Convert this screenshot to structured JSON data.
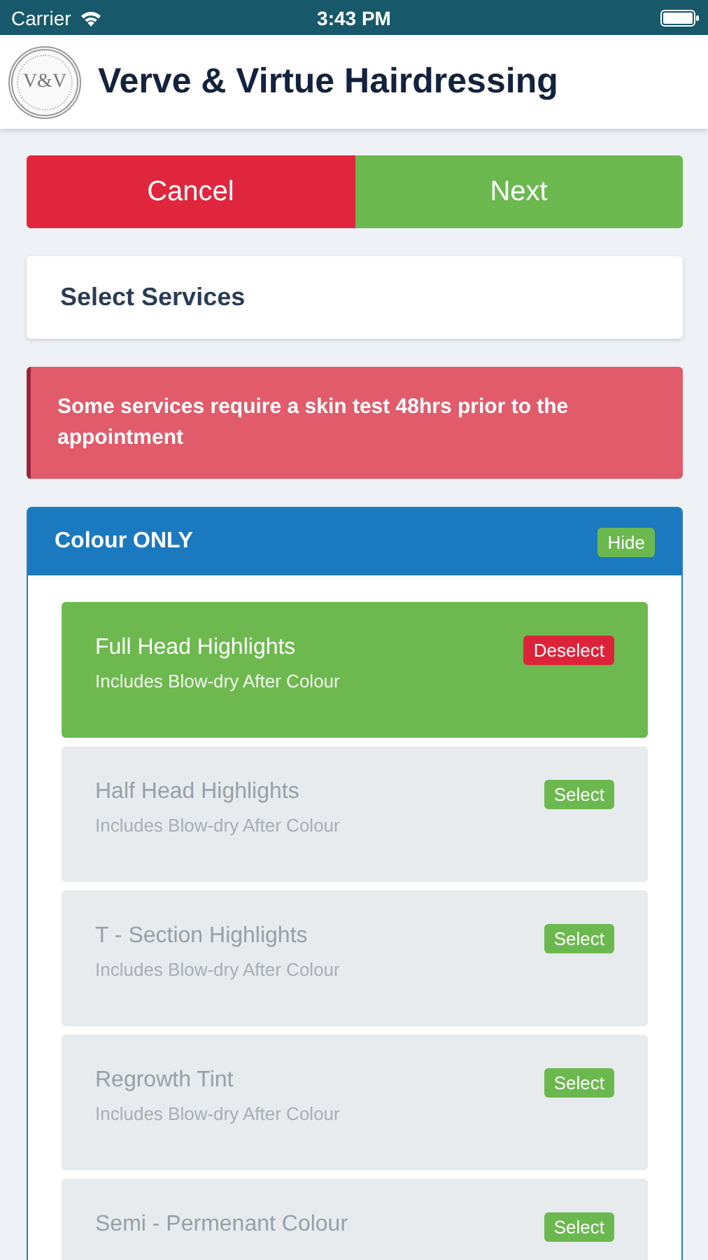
{
  "status_bar": {
    "carrier": "Carrier",
    "time": "3:43 PM"
  },
  "header": {
    "logo_text": "V&V",
    "title": "Verve & Virtue Hairdressing"
  },
  "actions": [
    {
      "label": "Cancel",
      "kind": "cancel"
    },
    {
      "label": "Next",
      "kind": "next"
    }
  ],
  "section_title": "Select Services",
  "alert": "Some services require a skin test 48hrs prior to the appointment",
  "category": {
    "title": "Colour ONLY",
    "toggle": "Hide",
    "services": [
      {
        "name": "Full Head Highlights",
        "note": "Includes Blow-dry After Colour",
        "selected": true,
        "action": "Deselect"
      },
      {
        "name": "Half Head Highlights",
        "note": "Includes Blow-dry After Colour",
        "selected": false,
        "action": "Select"
      },
      {
        "name": "T - Section Highlights",
        "note": "Includes Blow-dry After Colour",
        "selected": false,
        "action": "Select"
      },
      {
        "name": "Regrowth Tint",
        "note": "Includes Blow-dry After Colour",
        "selected": false,
        "action": "Select"
      },
      {
        "name": "Semi - Permenant Colour",
        "selected": false,
        "action": "Select"
      }
    ]
  }
}
